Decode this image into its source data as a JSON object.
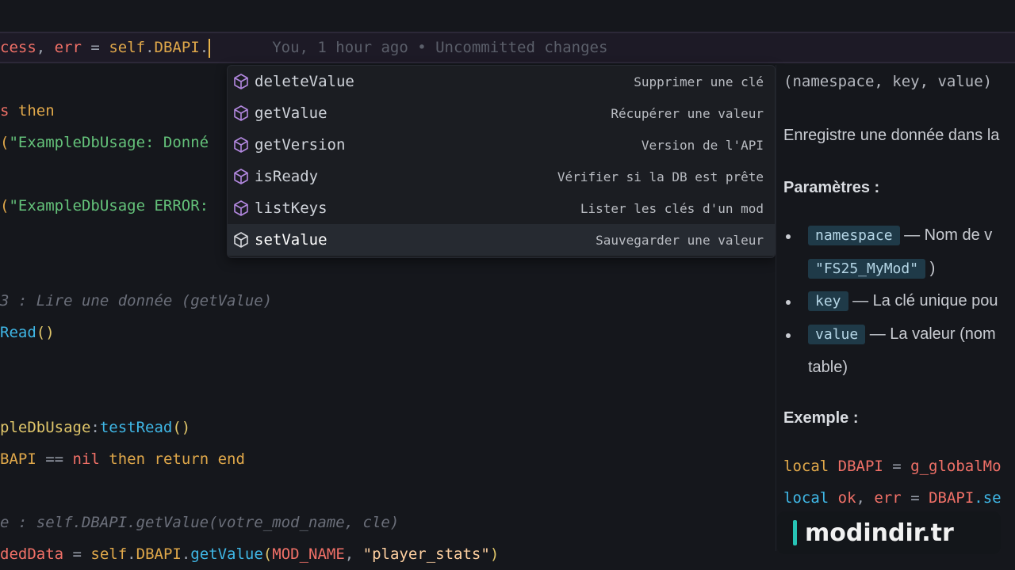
{
  "editor": {
    "current_line": {
      "part1": "cess",
      "comma1": ", ",
      "part2": "err",
      "eq": " = ",
      "part3": "self",
      "dot": ".",
      "part4": "DBAPI",
      "dot2": ".",
      "blame": "You, 1 hour ago • Uncommitted changes"
    },
    "line_then": {
      "a": "s ",
      "b": "then"
    },
    "line_print1": {
      "a": "(",
      "b": "\"ExampleDbUsage: Donné"
    },
    "line_print2": {
      "a": "(",
      "b": "\"ExampleDbUsage ERROR:"
    },
    "line_comment1": "3 : Lire une donnée (getValue)",
    "line_read": {
      "a": "Read",
      "b": "()"
    },
    "line_func": {
      "a": "pleDbUsage",
      "b": ":",
      "c": "testRead",
      "d": "()"
    },
    "line_check": {
      "a": "BAPI",
      "b": " == ",
      "c": "nil",
      "d": " then ",
      "e": "return",
      "f": " end"
    },
    "line_comment2": "e : self.DBAPI.getValue(votre_mod_name, cle)",
    "line_loaded": {
      "a": "dedData",
      "b": " = ",
      "c": "self",
      "d": ".",
      "e": "DBAPI",
      "f": ".",
      "g": "getValue",
      "h": "(",
      "i": "MOD_NAME",
      "j": ", ",
      "k": "\"player_stats\"",
      "l": ")"
    }
  },
  "suggestions": [
    {
      "label": "deleteValue",
      "detail": "Supprimer une clé",
      "icon": "method-cube-icon"
    },
    {
      "label": "getValue",
      "detail": "Récupérer une valeur",
      "icon": "method-cube-icon"
    },
    {
      "label": "getVersion",
      "detail": "Version de l'API",
      "icon": "method-cube-icon"
    },
    {
      "label": "isReady",
      "detail": "Vérifier si la DB est prête",
      "icon": "method-cube-icon"
    },
    {
      "label": "listKeys",
      "detail": "Lister les clés d'un mod",
      "icon": "method-cube-icon"
    },
    {
      "label": "setValue",
      "detail": "Sauvegarder une valeur",
      "icon": "method-cube-icon",
      "selected": true
    }
  ],
  "docs": {
    "signature": "(namespace, key, value)",
    "description": "Enregistre une donnée dans la",
    "params_heading": "Paramètres :",
    "params": [
      {
        "name": "namespace",
        "text": " — Nom de v",
        "extra_chip": "\"FS25_MyMod\"",
        "extra_tail": ")"
      },
      {
        "name": "key",
        "text": " — La clé unique pou"
      },
      {
        "name": "value",
        "text": " — La valeur (nom",
        "cont": "table)"
      }
    ],
    "example_heading": "Exemple :",
    "code1": {
      "kw": "local",
      "var": " DBAPI",
      "eq": " = ",
      "rest": "g_globalMo"
    },
    "code2": {
      "kw": "local",
      "var": " ok",
      "comma": ", ",
      "var2": "err",
      "eq": " = ",
      "rest": "DBAPI",
      "tail": ".se"
    }
  },
  "watermark": "modindir.tr"
}
